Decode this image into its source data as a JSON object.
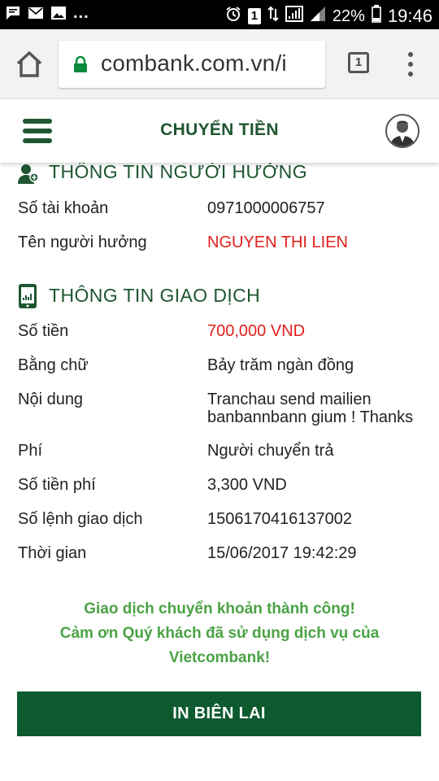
{
  "status_bar": {
    "battery": "22%",
    "time": "19:46",
    "notification_badge": "1",
    "more_dots": "..."
  },
  "browser": {
    "url": "combank.com.vn/i",
    "tab_count": "1"
  },
  "header": {
    "title": "CHUYỂN TIỀN"
  },
  "beneficiary": {
    "title": "THÔNG TIN NGƯỜI HƯỞNG",
    "rows": [
      {
        "label": "Số tài khoản",
        "value": "0971000006757"
      },
      {
        "label": "Tên người hưởng",
        "value": "NGUYEN THI LIEN"
      }
    ]
  },
  "transaction": {
    "title": "THÔNG TIN GIAO DỊCH",
    "rows": [
      {
        "label": "Số tiền",
        "value": "700,000 VND"
      },
      {
        "label": "Bằng chữ",
        "value": "Bảy trăm ngàn đồng"
      },
      {
        "label": "Nội dung",
        "value": "Tranchau send mailien banbannbann gium ! Thanks"
      },
      {
        "label": "Phí",
        "value": "Người chuyển trả"
      },
      {
        "label": "Số tiền phí",
        "value": "3,300 VND"
      },
      {
        "label": "Số lệnh giao dịch",
        "value": "1506170416137002"
      },
      {
        "label": "Thời gian",
        "value": "15/06/2017 19:42:29"
      }
    ]
  },
  "success_message": {
    "line1": "Giao dịch chuyển khoản thành công!",
    "line2": "Cảm ơn Quý khách đã sử dụng dịch vụ của",
    "line3": "Vietcombank!"
  },
  "print_button": "IN BIÊN LAI",
  "colors": {
    "brand_green": "#1e5631",
    "button_green": "#0d5a2f",
    "success_green": "#4aa345",
    "highlight_red": "#e0201c"
  }
}
